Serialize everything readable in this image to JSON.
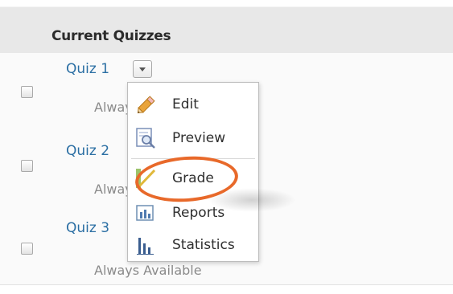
{
  "header": {
    "title": "Current Quizzes"
  },
  "quizzes": [
    {
      "name": "Quiz 1",
      "availability": "Always Available"
    },
    {
      "name": "Quiz 2",
      "availability": "Always Available"
    },
    {
      "name": "Quiz 3",
      "availability": "Always Available"
    }
  ],
  "menu": {
    "items": [
      {
        "label": "Edit",
        "icon": "pencil-icon"
      },
      {
        "label": "Preview",
        "icon": "preview-icon"
      },
      {
        "label": "Grade",
        "icon": "grade-icon"
      },
      {
        "label": "Reports",
        "icon": "reports-icon"
      },
      {
        "label": "Statistics",
        "icon": "statistics-icon"
      }
    ]
  },
  "colors": {
    "link": "#2a6ea3",
    "highlight": "#e8692a",
    "header_bg": "#e8e8e8"
  }
}
